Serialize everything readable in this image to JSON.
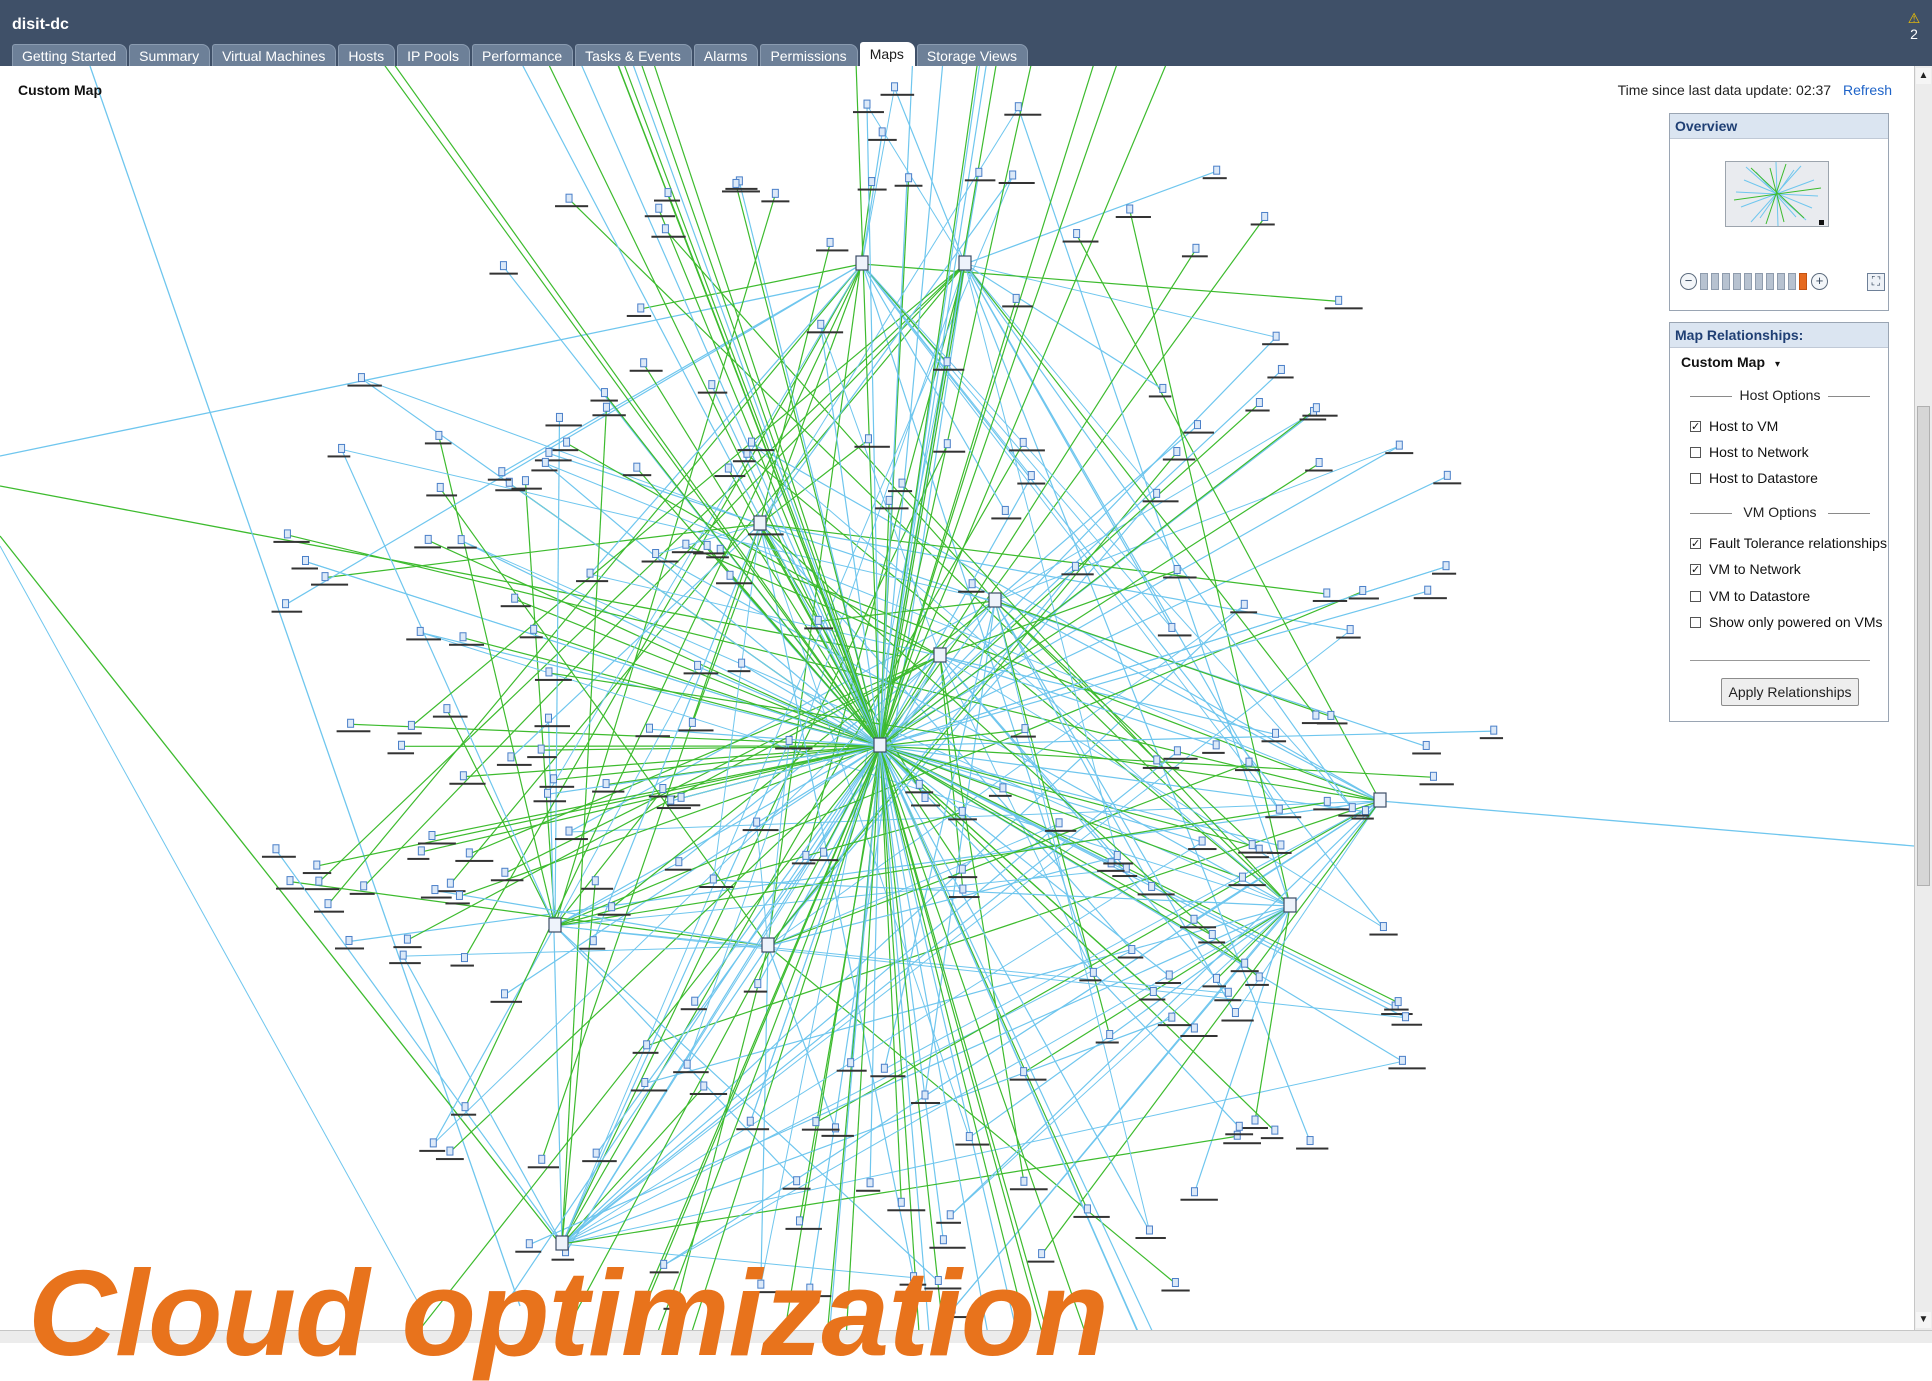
{
  "window": {
    "title": "disit-dc"
  },
  "alarm": {
    "icon": "warning-icon",
    "count": "2"
  },
  "tabs": [
    {
      "label": "Getting Started",
      "active": false
    },
    {
      "label": "Summary",
      "active": false
    },
    {
      "label": "Virtual Machines",
      "active": false
    },
    {
      "label": "Hosts",
      "active": false
    },
    {
      "label": "IP Pools",
      "active": false
    },
    {
      "label": "Performance",
      "active": false
    },
    {
      "label": "Tasks & Events",
      "active": false
    },
    {
      "label": "Alarms",
      "active": false
    },
    {
      "label": "Permissions",
      "active": false
    },
    {
      "label": "Maps",
      "active": true
    },
    {
      "label": "Storage Views",
      "active": false
    }
  ],
  "map": {
    "title": "Custom Map",
    "update_label": "Time since last data update: 02:37",
    "refresh_label": "Refresh",
    "colors": {
      "host_vm_edge": "#3dbb2e",
      "vm_network_edge": "#6fc6ee",
      "node": "#4a7fc8"
    }
  },
  "overview": {
    "title": "Overview",
    "zoom_out_icon": "zoom-out-icon",
    "zoom_in_icon": "zoom-in-icon",
    "fit_icon": "fit-to-window-icon",
    "zoom_level": 0.9
  },
  "relationships": {
    "title": "Map Relationships:",
    "selected": "Custom Map",
    "host_options_label": "Host Options",
    "host_options": [
      {
        "label": "Host to VM",
        "checked": true
      },
      {
        "label": "Host to Network",
        "checked": false
      },
      {
        "label": "Host to Datastore",
        "checked": false
      }
    ],
    "vm_options_label": "VM Options",
    "vm_options": [
      {
        "label": "Fault Tolerance relationships",
        "checked": true
      },
      {
        "label": "VM to Network",
        "checked": true
      },
      {
        "label": "VM to Datastore",
        "checked": false
      },
      {
        "label": "Show only powered on VMs",
        "checked": false
      }
    ],
    "apply_label": "Apply Relationships"
  },
  "headline": "Cloud optimization"
}
